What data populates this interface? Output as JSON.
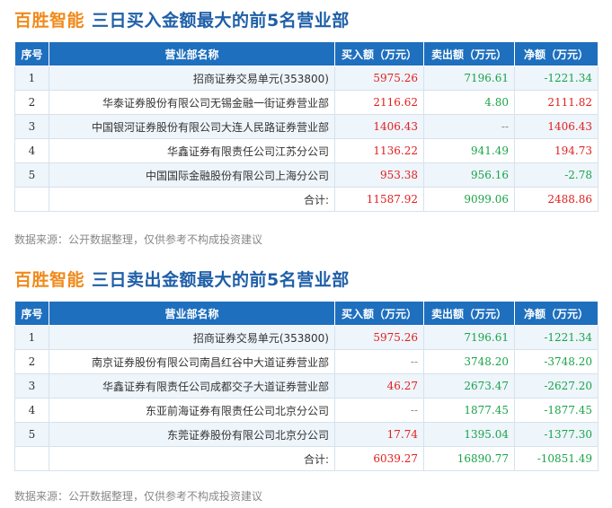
{
  "colors": {
    "title_name": "#f08a1c",
    "title_sub": "#1f5fa8",
    "header_bg": "#1e6fbe",
    "positive": "#e02020",
    "negative": "#1aa34a",
    "row_alt": "#eef5fb"
  },
  "columns": [
    "序号",
    "营业部名称",
    "买入额（万元）",
    "卖出额（万元）",
    "净额（万元）"
  ],
  "source_note": "数据来源：公开数据整理，仅供参考不构成投资建议",
  "buy_section": {
    "stock_name": "百胜智能",
    "title": "三日买入金额最大的前5名营业部",
    "rows": [
      {
        "idx": "1",
        "name": "招商证券交易单元(353800)",
        "buy": "5975.26",
        "sell": "7196.61",
        "net": "-1221.34"
      },
      {
        "idx": "2",
        "name": "华泰证券股份有限公司无锡金融一街证券营业部",
        "buy": "2116.62",
        "sell": "4.80",
        "net": "2111.82"
      },
      {
        "idx": "3",
        "name": "中国银河证券股份有限公司大连人民路证券营业部",
        "buy": "1406.43",
        "sell": "--",
        "net": "1406.43"
      },
      {
        "idx": "4",
        "name": "华鑫证券有限责任公司江苏分公司",
        "buy": "1136.22",
        "sell": "941.49",
        "net": "194.73"
      },
      {
        "idx": "5",
        "name": "中国国际金融股份有限公司上海分公司",
        "buy": "953.38",
        "sell": "956.16",
        "net": "-2.78"
      }
    ],
    "total": {
      "label": "合计:",
      "buy": "11587.92",
      "sell": "9099.06",
      "net": "2488.86"
    }
  },
  "sell_section": {
    "stock_name": "百胜智能",
    "title": "三日卖出金额最大的前5名营业部",
    "rows": [
      {
        "idx": "1",
        "name": "招商证券交易单元(353800)",
        "buy": "5975.26",
        "sell": "7196.61",
        "net": "-1221.34"
      },
      {
        "idx": "2",
        "name": "南京证券股份有限公司南昌红谷中大道证券营业部",
        "buy": "--",
        "sell": "3748.20",
        "net": "-3748.20"
      },
      {
        "idx": "3",
        "name": "华鑫证券有限责任公司成都交子大道证券营业部",
        "buy": "46.27",
        "sell": "2673.47",
        "net": "-2627.20"
      },
      {
        "idx": "4",
        "name": "东亚前海证券有限责任公司北京分公司",
        "buy": "--",
        "sell": "1877.45",
        "net": "-1877.45"
      },
      {
        "idx": "5",
        "name": "东莞证券股份有限公司北京分公司",
        "buy": "17.74",
        "sell": "1395.04",
        "net": "-1377.30"
      }
    ],
    "total": {
      "label": "合计:",
      "buy": "6039.27",
      "sell": "16890.77",
      "net": "-10851.49"
    }
  }
}
